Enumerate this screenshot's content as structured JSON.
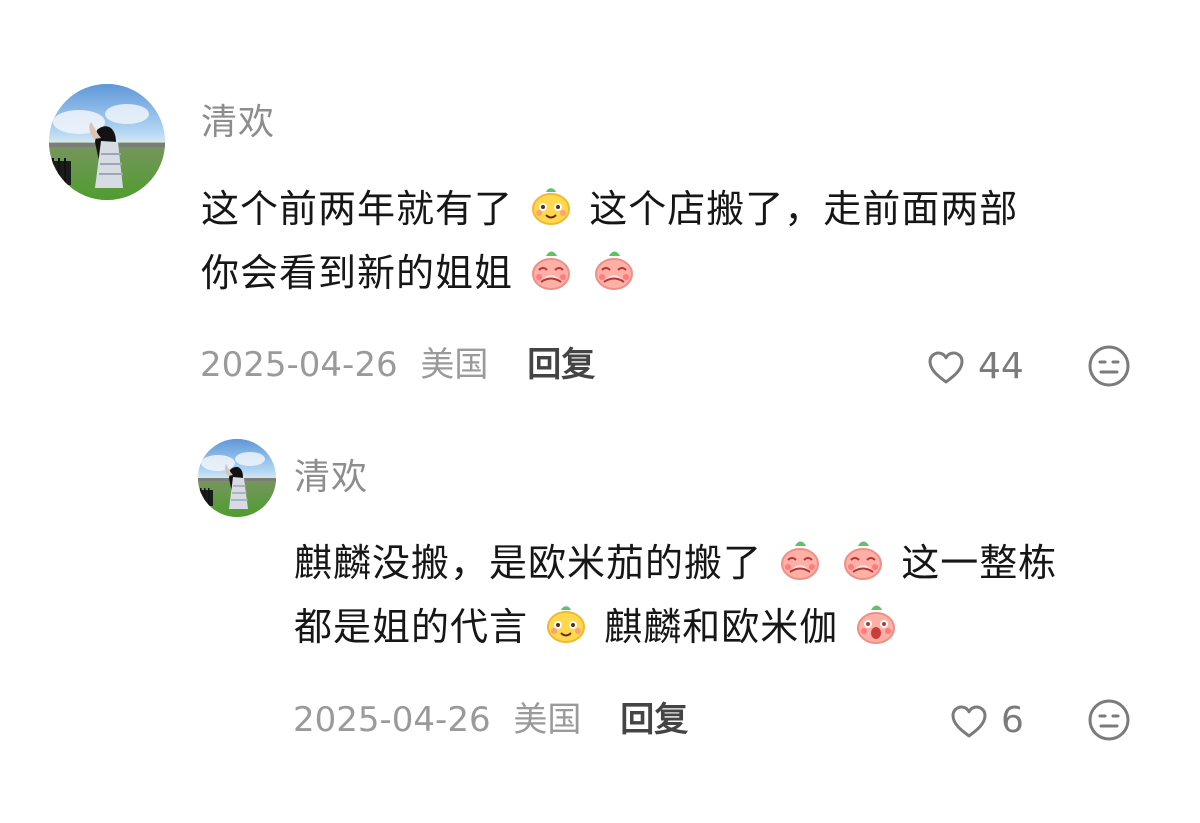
{
  "comments": [
    {
      "user": "清欢",
      "text_line_1": "这个前两年就有了",
      "text_line_1b": "这个店搬了，走前面两部",
      "text_line_2": "你会看到新的姐姐",
      "date": "2025-04-26",
      "region": "美国",
      "reply_label": "回复",
      "likes": "44"
    },
    {
      "user": "清欢",
      "text_line_1": "麒麟没搬，是欧米茄的搬了",
      "text_line_1b": "这一整栋",
      "text_line_2": "都是姐的代言",
      "text_line_2b": "麒麟和欧米伽",
      "date": "2025-04-26",
      "region": "美国",
      "reply_label": "回复",
      "likes": "6"
    }
  ],
  "icons": {
    "like": "heart-outline-icon",
    "react": "neutral-face-icon",
    "emoji_yellow": "smiling-pear-emoji",
    "emoji_pink": "shy-peach-emoji",
    "emoji_pink_surprised": "surprised-peach-emoji"
  },
  "colors": {
    "text": "#161616",
    "username": "#8d8d8d",
    "meta": "#9a9a9a",
    "reply": "#444444",
    "icon": "#7b7b7b"
  }
}
